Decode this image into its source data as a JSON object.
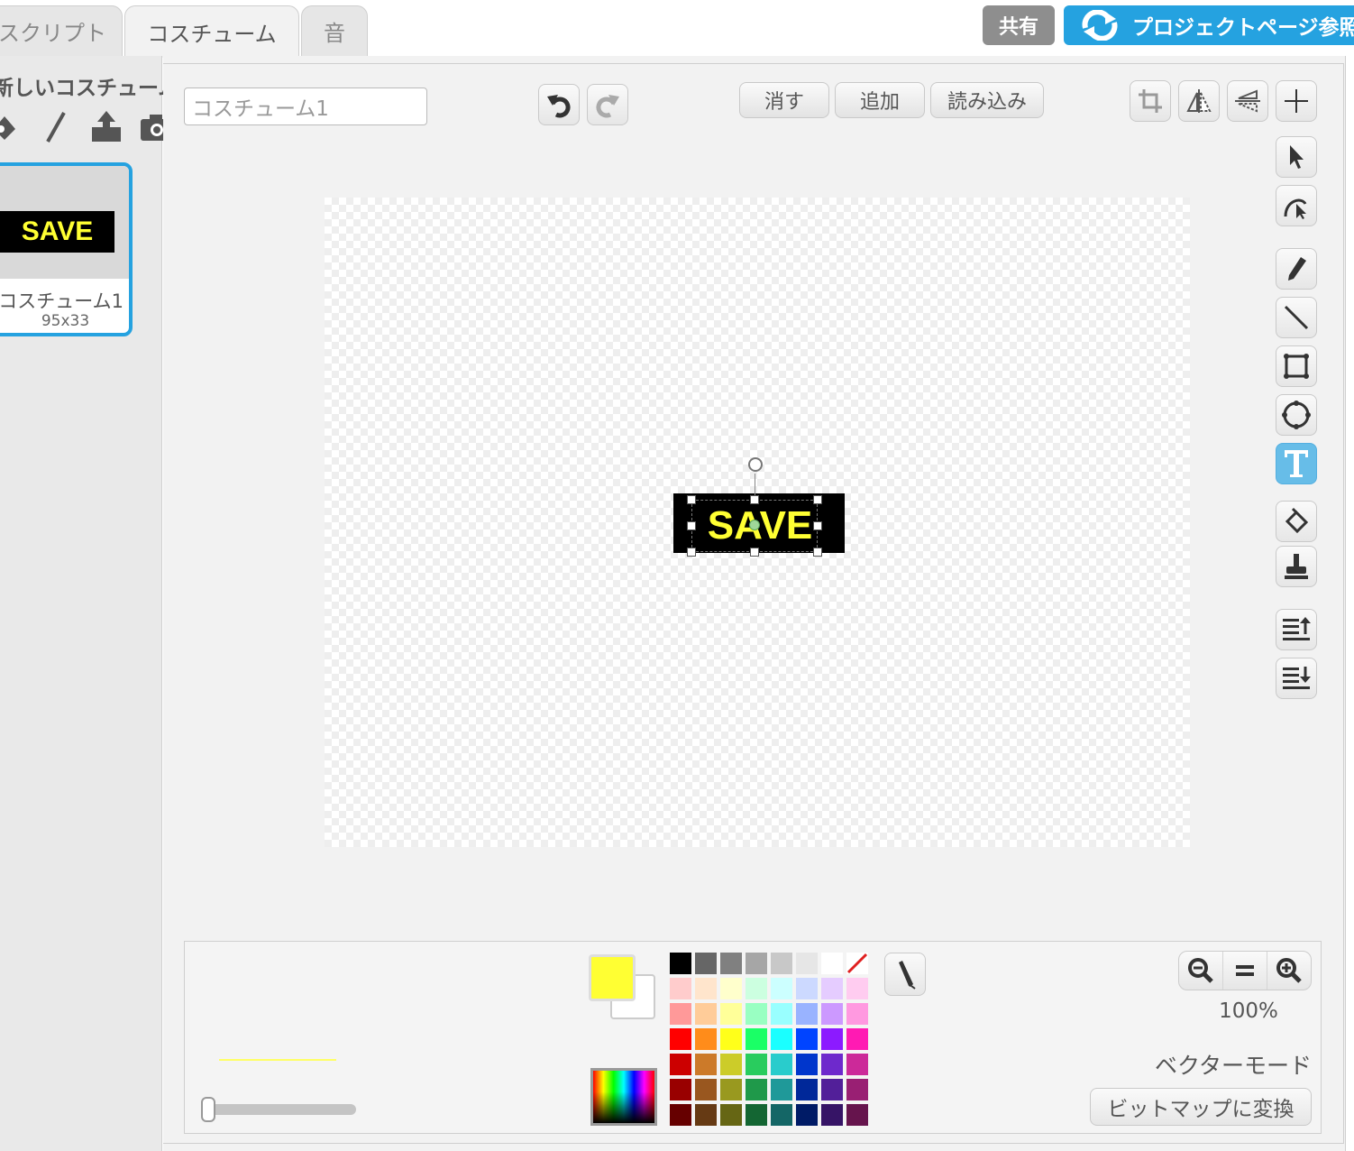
{
  "tabs": [
    {
      "label": "スクリプト"
    },
    {
      "label": "コスチューム"
    },
    {
      "label": "音"
    }
  ],
  "header": {
    "share_label": "共有",
    "project_label": "プロジェクトページ参照"
  },
  "left": {
    "new_costume_label": "新しいコスチューム:",
    "tools": [
      "sprite-library-icon",
      "paint-brush-icon",
      "upload-icon",
      "camera-icon"
    ],
    "costume": {
      "name": "コスチューム1",
      "size": "95x33",
      "art_text": "SAVE"
    }
  },
  "editor": {
    "costume_name_value": "コスチューム1",
    "clear_label": "消す",
    "add_label": "追加",
    "import_label": "読み込み",
    "canvas_text": "SAVE",
    "selected_tool": "text-tool",
    "zoom_level": "100%",
    "mode_label": "ベクターモード",
    "convert_label": "ビットマップに変換",
    "fill_color": "#ffff33",
    "secondary_color": "#ffffff"
  },
  "palette": [
    "#000000",
    "#666666",
    "#808080",
    "#a6a6a6",
    "#c8c8c8",
    "#e6e6e6",
    "#ffffff",
    "none",
    "#ffcccc",
    "#ffe5cc",
    "#ffffcc",
    "#ccffe0",
    "#ccffff",
    "#ccd9ff",
    "#e5ccff",
    "#ffccf0",
    "#ff9999",
    "#ffcc99",
    "#ffff99",
    "#99ffc2",
    "#99ffff",
    "#99b3ff",
    "#cc99ff",
    "#ff99e0",
    "#ff0000",
    "#ff8c1a",
    "#ffff1a",
    "#1aff66",
    "#1affff",
    "#0044ff",
    "#8c1aff",
    "#ff1ab3",
    "#cc0000",
    "#cc7a29",
    "#cccc29",
    "#29cc5e",
    "#29cccc",
    "#0036cc",
    "#6e29cc",
    "#cc2999",
    "#990000",
    "#99571f",
    "#99991f",
    "#1f994a",
    "#1f9999",
    "#002899",
    "#521f99",
    "#991f73",
    "#660000",
    "#663a14",
    "#666614",
    "#146633",
    "#146666",
    "#001b66",
    "#361466",
    "#66144d"
  ]
}
